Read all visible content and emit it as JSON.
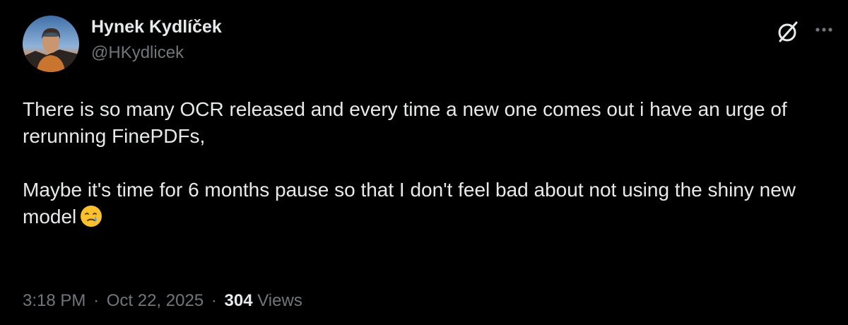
{
  "post": {
    "author": {
      "display_name": "Hynek Kydlíček",
      "handle": "@HKydlicek",
      "avatar_icon": "profile-photo"
    },
    "header_actions": [
      {
        "icon": "grok-icon"
      },
      {
        "icon": "more-horizontal-icon"
      }
    ],
    "text": {
      "paragraph_1": "There is so many OCR released and every time a new one comes out i have an urge of rerunning FinePDFs,",
      "paragraph_2": "Maybe it's time for 6 months pause so that I don't feel bad about not using the shiny new model",
      "paragraph_2_emoji": "face-holding-back-tears"
    },
    "meta": {
      "time": "3:18 PM",
      "separator": "·",
      "date": "Oct 22, 2025",
      "views_count": "304",
      "views_label": "Views"
    }
  },
  "colors": {
    "background": "#000000",
    "primary_text": "#e7e9ea",
    "secondary_text": "#71767b",
    "emoji_yellow": "#fbc02d",
    "tear_blue": "#4fa3f7"
  }
}
